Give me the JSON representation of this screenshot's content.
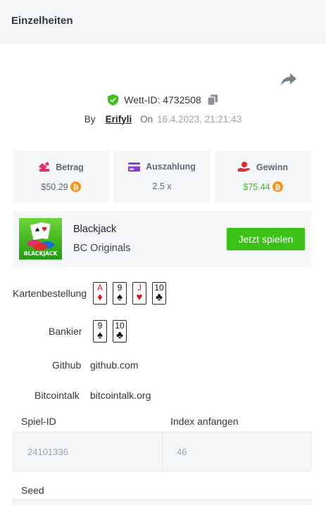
{
  "header": {
    "title": "Einzelheiten"
  },
  "bet": {
    "id_label": "Wett-ID: 4732508",
    "by": "By",
    "user": "Erifyli",
    "on": "On",
    "date": "16.4.2023, 21:21:43"
  },
  "stats": {
    "amount": {
      "label": "Betrag",
      "value": "$50.29"
    },
    "payout": {
      "label": "Auszahlung",
      "value": "2.5 x"
    },
    "profit": {
      "label": "Gewinn",
      "value": "$75.44"
    }
  },
  "game": {
    "name": "Blackjack",
    "provider": "BC Originals",
    "thumb_text": "BLACKJACK",
    "play_label": "Jetzt spielen"
  },
  "card_order": {
    "label": "Kartenbestellung",
    "cards": [
      {
        "rank": "A",
        "suit": "♦",
        "color": "red"
      },
      {
        "rank": "9",
        "suit": "♠",
        "color": "black"
      },
      {
        "rank": "J",
        "suit": "♥",
        "color": "red"
      },
      {
        "rank": "10",
        "suit": "♣",
        "color": "black"
      }
    ]
  },
  "banker": {
    "label": "Bankier",
    "cards": [
      {
        "rank": "9",
        "suit": "♠",
        "color": "black"
      },
      {
        "rank": "10",
        "suit": "♣",
        "color": "black"
      }
    ]
  },
  "links": {
    "github_label": "Github",
    "github_value": "github.com",
    "bitcointalk_label": "Bitcointalk",
    "bitcointalk_value": "bitcointalk.org"
  },
  "fields": {
    "game_id_label": "Spiel-ID",
    "game_id_value": "24101336",
    "start_index_label": "Index anfangen",
    "start_index_value": "46",
    "seed_label": "Seed"
  },
  "colors": {
    "accent_green": "#3bc117",
    "panel_bg": "#f5f6f7",
    "coin_orange": "#f7931a",
    "icon_pink": "#e3306d",
    "icon_purple": "#8b3ad8",
    "icon_red": "#e02d2d"
  }
}
